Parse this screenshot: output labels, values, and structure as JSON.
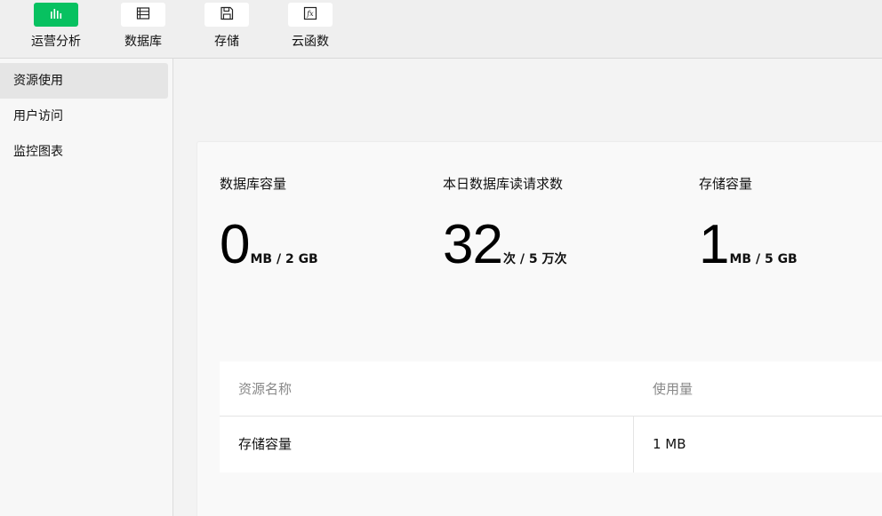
{
  "toolbar": {
    "items": [
      {
        "label": "运营分析",
        "icon": "bar-chart-icon",
        "active": true
      },
      {
        "label": "数据库",
        "icon": "database-icon",
        "active": false
      },
      {
        "label": "存储",
        "icon": "save-icon",
        "active": false
      },
      {
        "label": "云函数",
        "icon": "function-icon",
        "active": false
      }
    ]
  },
  "sidebar": {
    "items": [
      {
        "label": "资源使用",
        "active": true
      },
      {
        "label": "用户访问",
        "active": false
      },
      {
        "label": "监控图表",
        "active": false
      }
    ]
  },
  "stats": [
    {
      "label": "数据库容量",
      "value": "0",
      "unit": "MB / 2 GB"
    },
    {
      "label": "本日数据库读请求数",
      "value": "32",
      "unit": "次 / 5 万次"
    },
    {
      "label": "存储容量",
      "value": "1",
      "unit": "MB / 5 GB"
    }
  ],
  "table": {
    "headers": [
      "资源名称",
      "使用量"
    ],
    "rows": [
      [
        "存储容量",
        "1 MB"
      ]
    ]
  },
  "colors": {
    "accent": "#07c160",
    "toolbar_bg": "#efefef",
    "sidebar_bg": "#f7f7f7",
    "sidebar_active_bg": "#e5e5e5"
  }
}
